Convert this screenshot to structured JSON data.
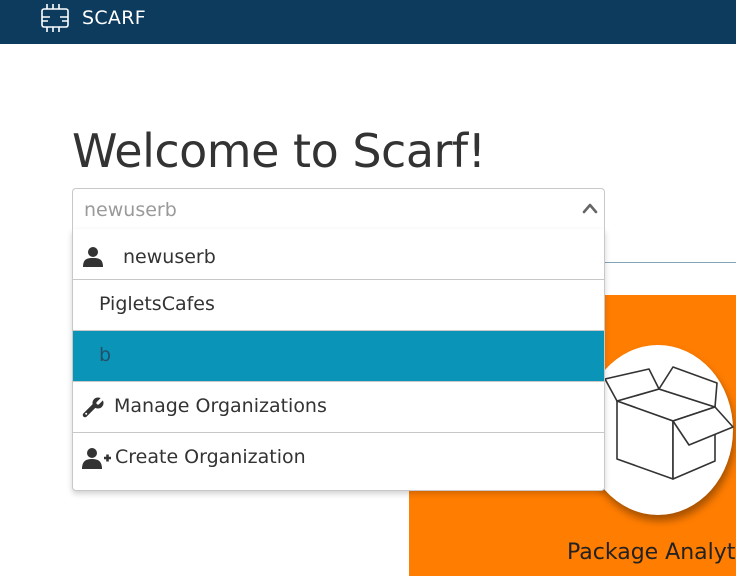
{
  "header": {
    "brand_name": "SCARF",
    "logo_icon": "chip-icon",
    "background": "#0d3b5e"
  },
  "main": {
    "title": "Welcome to Scarf!"
  },
  "select": {
    "current_value": "newuserb",
    "indicator_icon": "chevron-up-icon",
    "options": [
      {
        "label": "newuserb",
        "icon": "user-icon"
      },
      {
        "label": "PigletsCafes"
      },
      {
        "label": "b",
        "selected": true
      },
      {
        "label": "Manage Organizations",
        "icon": "wrench-icon"
      },
      {
        "label": "Create Organization",
        "icon": "user-plus-icon"
      }
    ]
  },
  "card": {
    "caption": "Package Analytics",
    "icon": "open-box-icon",
    "background": "#ff7d00"
  },
  "colors": {
    "accent": "#0a95b8",
    "brand": "#0d3b5e",
    "orange": "#ff7d00"
  }
}
